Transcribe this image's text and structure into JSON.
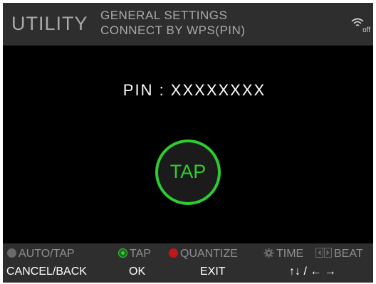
{
  "header": {
    "title": "UTILITY",
    "path_line1": "GENERAL SETTINGS",
    "path_line2": "CONNECT BY WPS(PIN)",
    "wifi_status": "off",
    "wifi_icon": "wifi-icon"
  },
  "main": {
    "pin_text": "PIN : XXXXXXXX",
    "tap_label": "TAP",
    "accent_color": "#2ecc2e"
  },
  "legend": {
    "auto_tap": "AUTO/TAP",
    "tap": "TAP",
    "quantize": "QUANTIZE",
    "time": "TIME",
    "beat": "BEAT"
  },
  "actions": {
    "cancel_back": "CANCEL/BACK",
    "ok": "OK",
    "exit": "EXIT",
    "navigate": "↑↓ / ← →"
  }
}
